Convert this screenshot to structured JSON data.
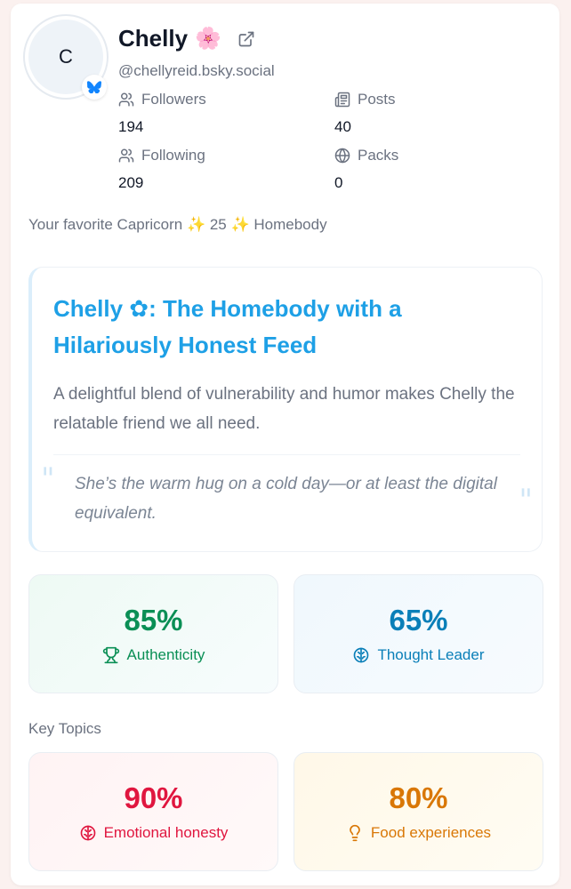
{
  "profile": {
    "avatar_initial": "C",
    "name": "Chelly",
    "name_emoji": "🌸",
    "handle": "@chellyreid.bsky.social",
    "bio": "Your favorite Capricorn ✨ 25 ✨ Homebody",
    "brand_color": "#1185fe"
  },
  "stats": {
    "followers": {
      "label": "Followers",
      "value": "194",
      "icon": "users-icon"
    },
    "posts": {
      "label": "Posts",
      "value": "40",
      "icon": "newspaper-icon"
    },
    "following": {
      "label": "Following",
      "value": "209",
      "icon": "users-icon"
    },
    "packs": {
      "label": "Packs",
      "value": "0",
      "icon": "globe-icon"
    }
  },
  "summary": {
    "title_prefix": "Chelly",
    "title_emoji": "✿",
    "title_suffix": ": The Homebody with a Hilariously Honest Feed",
    "description": "A delightful blend of vulnerability and humor makes Chelly the relatable friend we all need.",
    "quote": "She’s the warm hug on a cold day—or at least the digital equivalent.",
    "accent_color": "#1ea0e6"
  },
  "traits": [
    {
      "value": "85%",
      "label": "Authenticity",
      "icon": "trophy-icon",
      "color": "#0a8f55"
    },
    {
      "value": "65%",
      "label": "Thought Leader",
      "icon": "brain-icon",
      "color": "#0a7fb8"
    }
  ],
  "key_topics": {
    "label": "Key Topics",
    "items": [
      {
        "value": "90%",
        "label": "Emotional honesty",
        "icon": "brain-icon",
        "color": "#e0163f"
      },
      {
        "value": "80%",
        "label": "Food experiences",
        "icon": "lightbulb-icon",
        "color": "#d97706"
      }
    ]
  }
}
